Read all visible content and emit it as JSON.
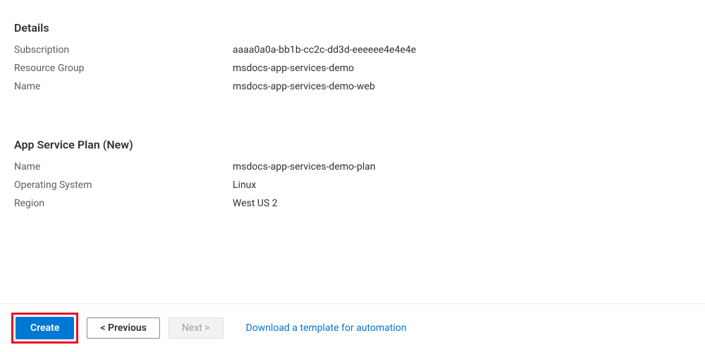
{
  "details": {
    "heading": "Details",
    "fields": [
      {
        "label": "Subscription",
        "value": "aaaa0a0a-bb1b-cc2c-dd3d-eeeeee4e4e4e"
      },
      {
        "label": "Resource Group",
        "value": "msdocs-app-services-demo"
      },
      {
        "label": "Name",
        "value": "msdocs-app-services-demo-web"
      }
    ]
  },
  "appServicePlan": {
    "heading": "App Service Plan (New)",
    "fields": [
      {
        "label": "Name",
        "value": "msdocs-app-services-demo-plan"
      },
      {
        "label": "Operating System",
        "value": "Linux"
      },
      {
        "label": "Region",
        "value": "West US 2"
      }
    ]
  },
  "footer": {
    "create": "Create",
    "previous": "<  Previous",
    "next": "Next  >",
    "downloadLink": "Download a template for automation"
  }
}
